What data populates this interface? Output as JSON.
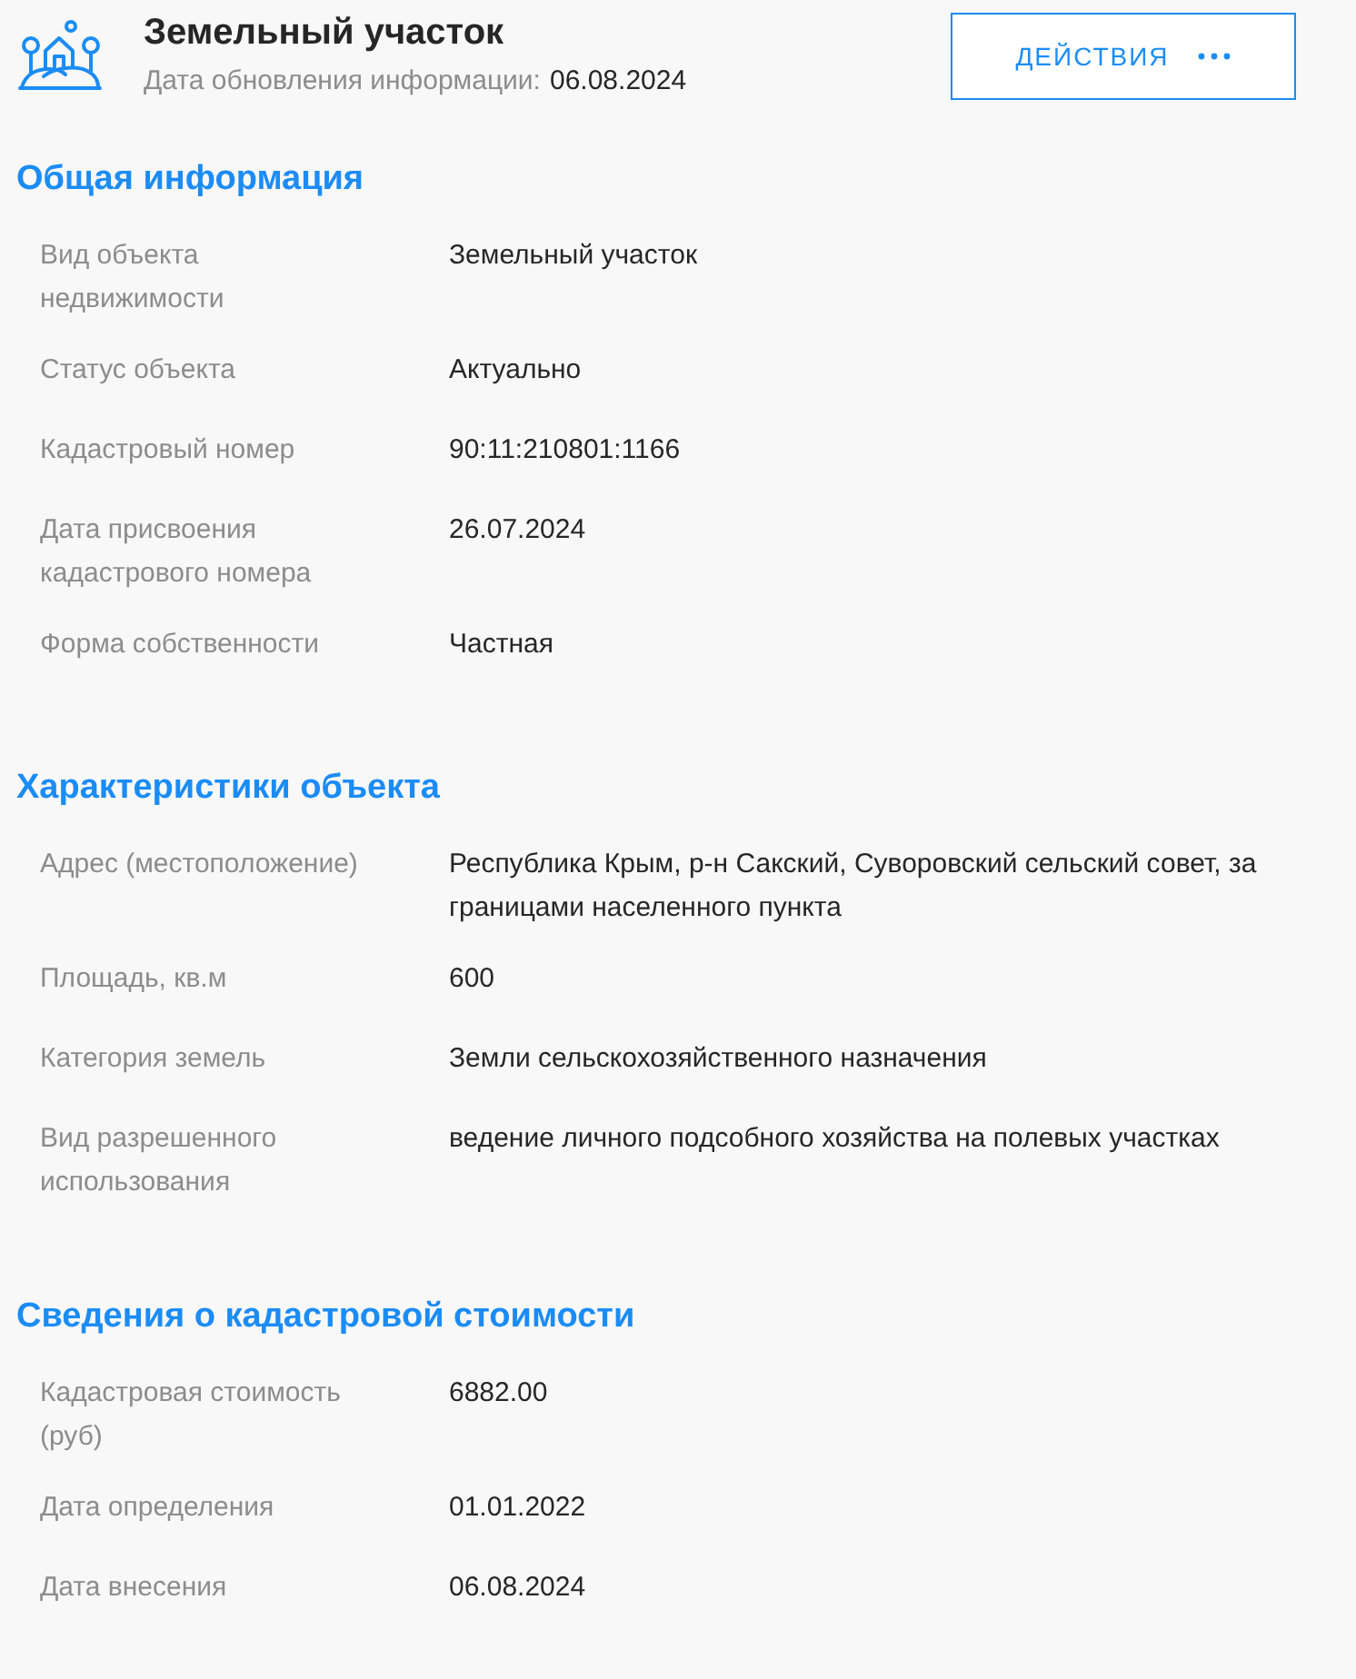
{
  "header": {
    "title": "Земельный участок",
    "updated": {
      "label": "Дата обновления информации:",
      "value": "06.08.2024"
    },
    "actions_button": "ДЕЙСТВИЯ"
  },
  "sections": [
    {
      "title": "Общая информация",
      "rows": [
        {
          "label": "Вид объекта недвижимости",
          "value": "Земельный участок"
        },
        {
          "label": "Статус объекта",
          "value": "Актуально"
        },
        {
          "label": "Кадастровый номер",
          "value": "90:11:210801:1166"
        },
        {
          "label": "Дата присвоения кадастрового номера",
          "value": "26.07.2024"
        },
        {
          "label": "Форма собственности",
          "value": "Частная"
        }
      ]
    },
    {
      "title": "Характеристики объекта",
      "rows": [
        {
          "label": "Адрес (местоположение)",
          "value": "Республика Крым, р-н Сакский, Суворовский сельский совет, за границами населенного пункта"
        },
        {
          "label": "Площадь, кв.м",
          "value": "600"
        },
        {
          "label": "Категория земель",
          "value": "Земли сельскохозяйственного назначения"
        },
        {
          "label": "Вид разрешенного использования",
          "value": "ведение личного подсобного хозяйства на полевых участках"
        }
      ]
    },
    {
      "title": "Сведения о кадастровой стоимости",
      "rows": [
        {
          "label": "Кадастровая стоимость (руб)",
          "value": "6882.00"
        },
        {
          "label": "Дата определения",
          "value": "01.01.2022"
        },
        {
          "label": "Дата внесения",
          "value": "06.08.2024"
        }
      ]
    }
  ]
}
